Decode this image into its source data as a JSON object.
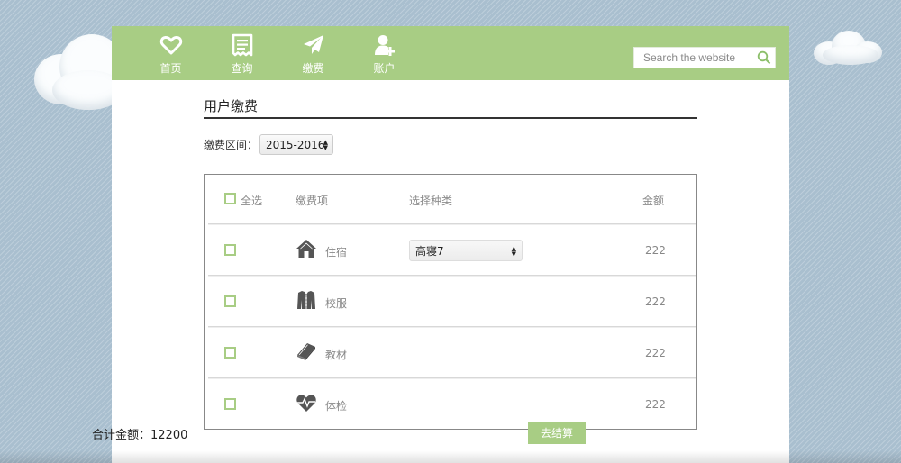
{
  "nav": {
    "items": [
      {
        "label": "首页",
        "icon": "heart-icon"
      },
      {
        "label": "查询",
        "icon": "receipt-icon"
      },
      {
        "label": "缴费",
        "icon": "paper-plane-icon"
      },
      {
        "label": "账户",
        "icon": "user-add-icon"
      }
    ]
  },
  "search": {
    "placeholder": "Search the website",
    "icon": "search-icon"
  },
  "page": {
    "title": "用户缴费"
  },
  "period": {
    "label": "缴费区间：",
    "selected": "2015-2016"
  },
  "table": {
    "headers": {
      "select_all": "全选",
      "item": "缴费项",
      "type": "选择种类",
      "amount": "金额"
    },
    "rows": [
      {
        "name": "住宿",
        "icon": "house-icon",
        "type": "高寝7",
        "amount": "222"
      },
      {
        "name": "校服",
        "icon": "jacket-icon",
        "type": "",
        "amount": "222"
      },
      {
        "name": "教材",
        "icon": "book-icon",
        "type": "",
        "amount": "222"
      },
      {
        "name": "体检",
        "icon": "heartbeat-icon",
        "type": "",
        "amount": "222"
      }
    ]
  },
  "footer": {
    "total": "合计金额：12200",
    "checkout_label": "去结算"
  },
  "colors": {
    "accent": "#a8cd84",
    "background": "#a9bfcf"
  }
}
